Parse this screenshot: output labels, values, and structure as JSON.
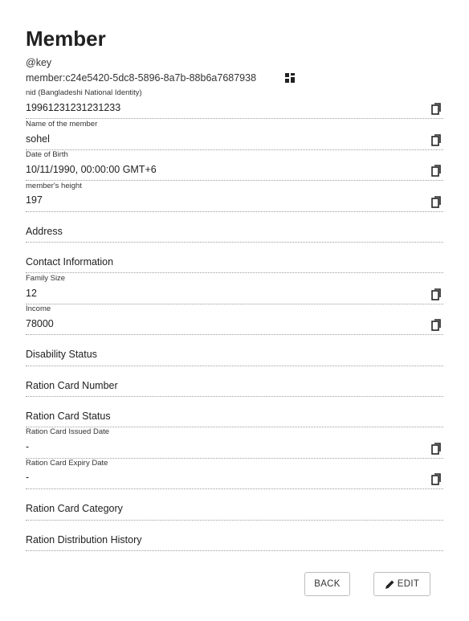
{
  "page": {
    "title": "Member",
    "key_label": "@key",
    "key_value": "member:c24e5420-5dc8-5896-8a7b-88b6a7687938"
  },
  "fields": {
    "nid": {
      "label": "nid (Bangladeshi National Identity)",
      "value": "19961231231231233"
    },
    "name": {
      "label": "Name of the member",
      "value": "sohel"
    },
    "dob": {
      "label": "Date of Birth",
      "value": "10/11/1990, 00:00:00 GMT+6"
    },
    "height": {
      "label": "member's height",
      "value": "197"
    },
    "family_size": {
      "label": "Family Size",
      "value": "12"
    },
    "income": {
      "label": "Income",
      "value": "78000"
    },
    "rc_issued": {
      "label": "Ration Card Issued Date",
      "value": "-"
    },
    "rc_expiry": {
      "label": "Ration Card Expiry Date",
      "value": "-"
    }
  },
  "sections": {
    "address": "Address",
    "contact": "Contact Information",
    "disability": "Disability Status",
    "rc_number": "Ration Card Number",
    "rc_status": "Ration Card Status",
    "rc_category": "Ration Card Category",
    "distribution": "Ration Distribution History"
  },
  "buttons": {
    "back": "BACK",
    "edit": "EDIT"
  },
  "icons": {
    "qr": "qr-code-icon",
    "copy": "copy-icon",
    "edit": "pencil-icon"
  }
}
